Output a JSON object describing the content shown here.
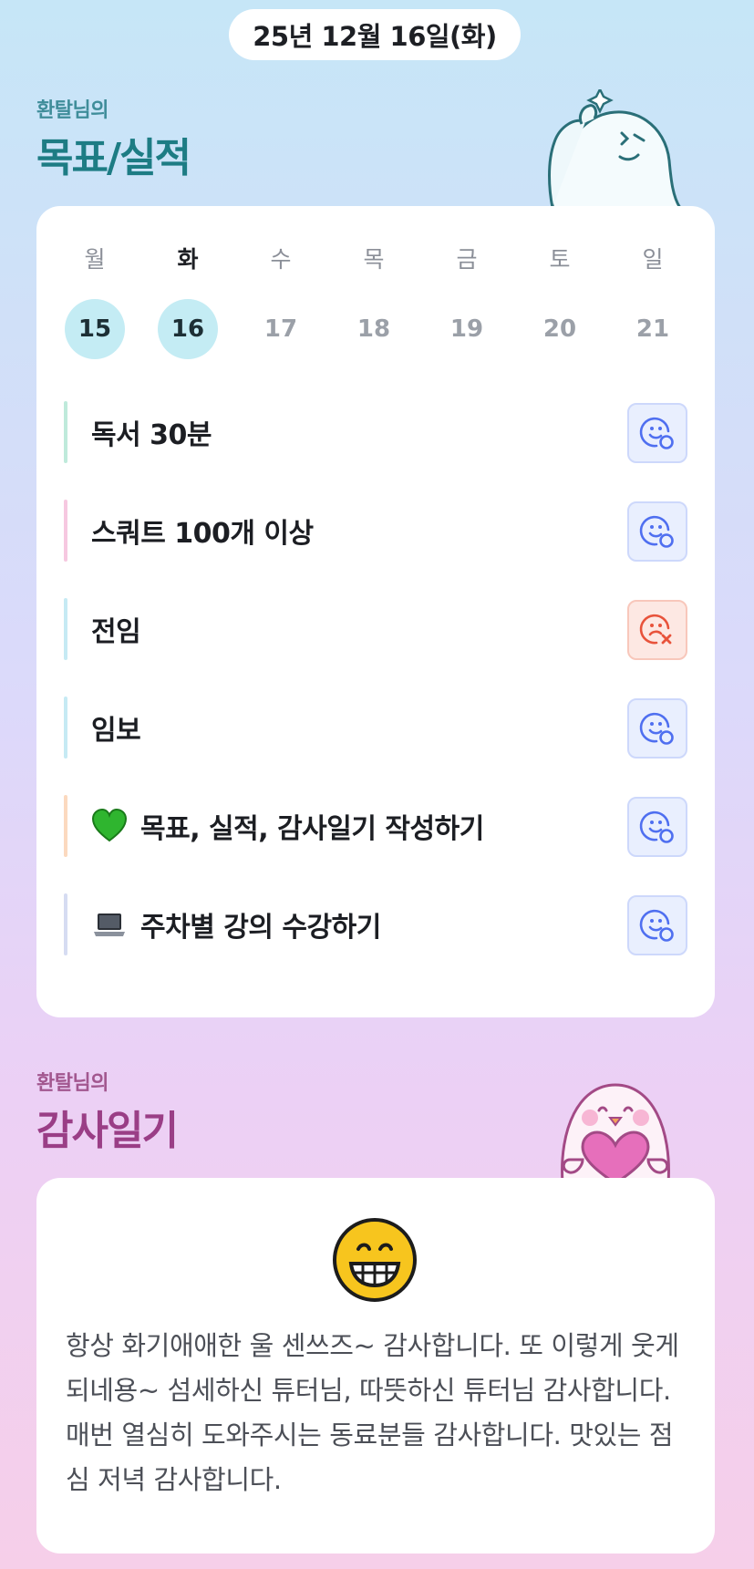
{
  "header": {
    "date": "25년 12월 16일(화)"
  },
  "goals_section": {
    "subtitle": "환탈님의",
    "title": "목표/실적"
  },
  "week": {
    "days": [
      {
        "name": "월",
        "date": "15",
        "done": true,
        "today": false
      },
      {
        "name": "화",
        "date": "16",
        "done": true,
        "today": true
      },
      {
        "name": "수",
        "date": "17",
        "done": false,
        "today": false
      },
      {
        "name": "목",
        "date": "18",
        "done": false,
        "today": false
      },
      {
        "name": "금",
        "date": "19",
        "done": false,
        "today": false
      },
      {
        "name": "토",
        "date": "20",
        "done": false,
        "today": false
      },
      {
        "name": "일",
        "date": "21",
        "done": false,
        "today": false
      }
    ]
  },
  "goals": [
    {
      "label": "독서 30분",
      "status": "success",
      "bar_color": "#bfeadb"
    },
    {
      "label": "스쿼트 100개 이상",
      "status": "success",
      "bar_color": "#f6c8e0"
    },
    {
      "label": "전임",
      "status": "fail",
      "bar_color": "#c6eaf4"
    },
    {
      "label": "임보",
      "status": "success",
      "bar_color": "#c6eaf4"
    },
    {
      "label": "목표, 실적, 감사일기 작성하기",
      "status": "success",
      "bar_color": "#fbd9bf",
      "icon": "green-heart-icon"
    },
    {
      "label": "주차별 강의 수강하기",
      "status": "success",
      "bar_color": "#d6dcf2",
      "icon": "laptop-icon"
    }
  ],
  "status_colors": {
    "success": "#4f6ff0",
    "fail": "#e8533b"
  },
  "thanks_section": {
    "subtitle": "환탈님의",
    "title": "감사일기"
  },
  "thanks": {
    "icon": "grinning-face-icon",
    "text": "항상 화기애애한 울 센쓰즈~ 감사합니다. 또 이렇게 웃게되네용~ 섬세하신 튜터님, 따뜻하신 튜터님 감사합니다. 매번 열심히 도와주시는 동료분들 감사합니다. 맛있는 점심 저녁 감사합니다."
  }
}
